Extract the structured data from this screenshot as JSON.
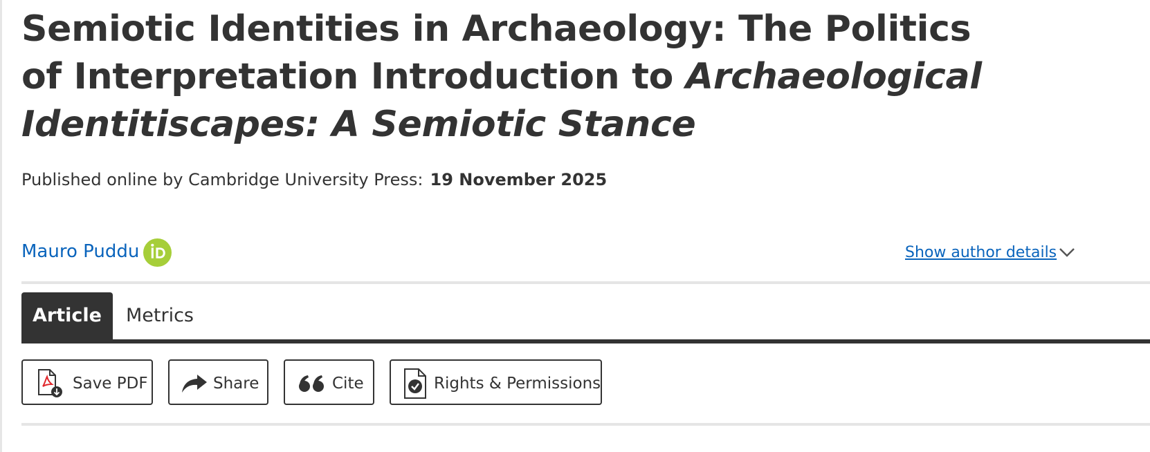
{
  "article": {
    "title_part1": "Semiotic Identities in Archaeology: The Politics of Interpretation Introduction to ",
    "title_part2": "Archaeological Identitiscapes: A Semiotic Stance",
    "published_label": "Published online by Cambridge University Press:",
    "published_date": "19 November 2025"
  },
  "author": {
    "name": "Mauro Puddu",
    "orcid_icon": "orcid-icon",
    "show_details_label": "Show author details",
    "chevron_icon": "chevron-down-icon"
  },
  "tabs": [
    {
      "label": "Article",
      "active": true
    },
    {
      "label": "Metrics",
      "active": false
    }
  ],
  "toolbar": {
    "save_pdf_label": "Save PDF",
    "share_label": "Share",
    "cite_label": "Cite",
    "rights_label": "Rights & Permissions"
  },
  "colors": {
    "text": "#333333",
    "link": "#0a64bc",
    "orcid": "#a6ce39",
    "pdf_red": "#e0262b",
    "divider": "#e5e5e5"
  }
}
